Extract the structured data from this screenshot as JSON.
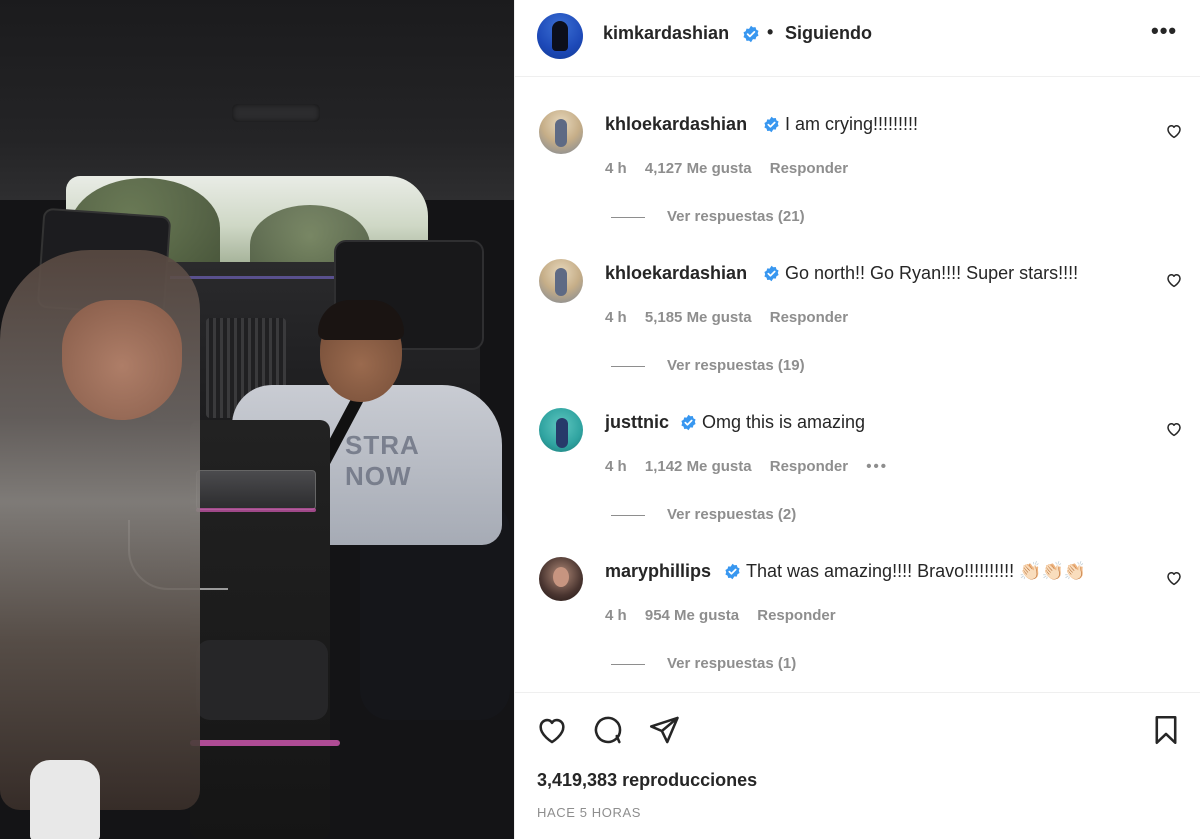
{
  "post": {
    "author": "kimkardashian",
    "follow_status": "Siguiendo",
    "separator": "•",
    "more_label": "•••",
    "views": "3,419,383 reproducciones",
    "time_ago": "HACE 5 HORAS"
  },
  "comments": [
    {
      "user": "khloekardashian",
      "text": "I am crying!!!!!!!!!",
      "time": "4 h",
      "likes": "4,127 Me gusta",
      "reply": "Responder",
      "replies": "Ver respuestas (21)"
    },
    {
      "user": "khloekardashian",
      "text": "Go north!! Go Ryan!!!! Super stars!!!!",
      "time": "4 h",
      "likes": "5,185 Me gusta",
      "reply": "Responder",
      "replies": "Ver respuestas (19)"
    },
    {
      "user": "justtnic",
      "text": "Omg this is amazing",
      "time": "4 h",
      "likes": "1,142 Me gusta",
      "reply": "Responder",
      "more": "•••",
      "replies": "Ver respuestas (2)"
    },
    {
      "user": "maryphillips",
      "text": "That was amazing!!!! Bravo!!!!!!!!!! 👏🏻👏🏻👏🏻",
      "time": "4 h",
      "likes": "954 Me gusta",
      "reply": "Responder",
      "replies": "Ver respuestas (1)"
    }
  ],
  "colors": {
    "text": "#262626",
    "secondary": "#8e8e8e",
    "verified": "#3897f0",
    "divider": "#efefef"
  },
  "icons": {
    "like": "heart-icon",
    "comment": "comment-icon",
    "share": "share-icon",
    "save": "bookmark-icon",
    "verified": "verified-badge-icon",
    "more": "more-options-icon"
  },
  "media": {
    "hoodie_text": "STRA\nNOW"
  }
}
